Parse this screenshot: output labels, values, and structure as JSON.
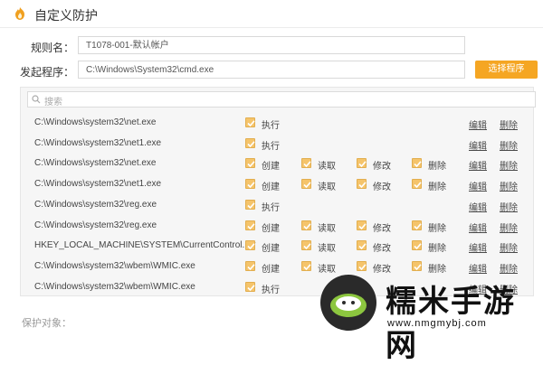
{
  "window": {
    "title": "自定义防护"
  },
  "form": {
    "rule_name_label": "规则名：",
    "rule_name_value": "T1078-001-默认帐户",
    "program_label": "发起程序：",
    "program_value": "C:\\Windows\\System32\\cmd.exe",
    "select_program_button": "选择程序"
  },
  "search": {
    "placeholder": "搜索"
  },
  "actions": {
    "edit": "编辑",
    "delete": "删除"
  },
  "rows": [
    {
      "path": "C:\\Windows\\system32\\net.exe",
      "perms": [
        "执行"
      ]
    },
    {
      "path": "C:\\Windows\\system32\\net1.exe",
      "perms": [
        "执行"
      ]
    },
    {
      "path": "C:\\Windows\\system32\\net.exe",
      "perms": [
        "创建",
        "读取",
        "修改",
        "删除"
      ]
    },
    {
      "path": "C:\\Windows\\system32\\net1.exe",
      "perms": [
        "创建",
        "读取",
        "修改",
        "删除"
      ]
    },
    {
      "path": "C:\\Windows\\system32\\reg.exe",
      "perms": [
        "执行"
      ]
    },
    {
      "path": "C:\\Windows\\system32\\reg.exe",
      "perms": [
        "创建",
        "读取",
        "修改",
        "删除"
      ]
    },
    {
      "path": "HKEY_LOCAL_MACHINE\\SYSTEM\\CurrentControl...\\*",
      "perms": [
        "创建",
        "读取",
        "修改",
        "删除"
      ]
    },
    {
      "path": "C:\\Windows\\system32\\wbem\\WMIC.exe",
      "perms": [
        "创建",
        "读取",
        "修改",
        "删除"
      ]
    },
    {
      "path": "C:\\Windows\\system32\\wbem\\WMIC.exe",
      "perms": [
        "执行"
      ]
    }
  ],
  "footer": {
    "protected_object_label": "保护对象："
  },
  "watermark": {
    "brand_text": "糯米手游网",
    "url": "www.nmgmybj.com"
  },
  "colors": {
    "accent": "#f5a623",
    "checkbox": "#f5c46b"
  }
}
